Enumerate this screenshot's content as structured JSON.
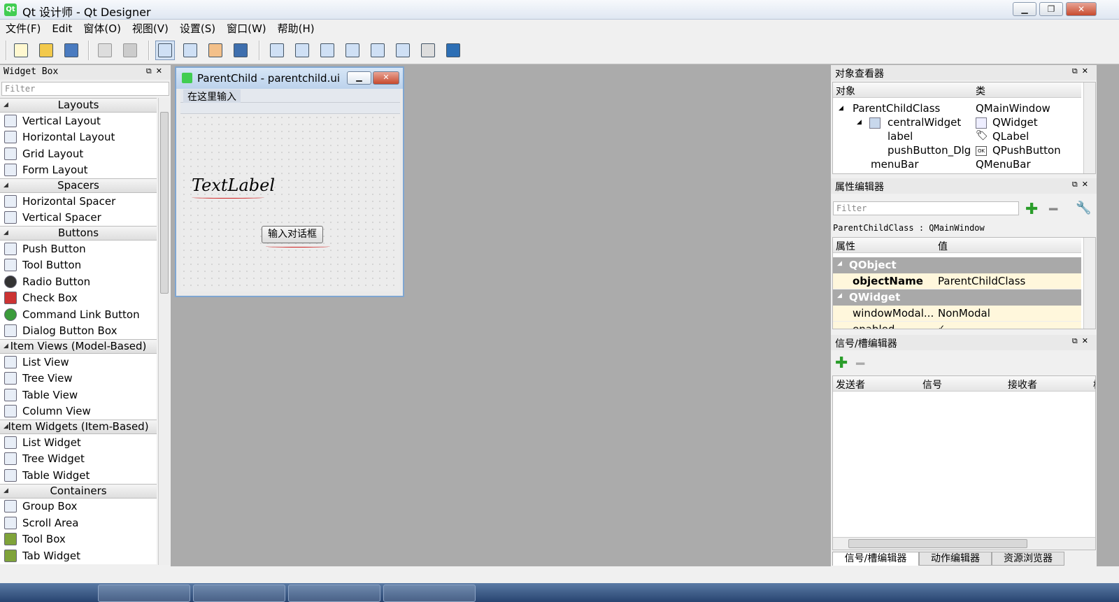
{
  "window": {
    "title": "Qt 设计师 - Qt Designer",
    "icon_text": "Qt",
    "min_icon": "minimize-icon",
    "max_icon": "maximize-icon",
    "close_icon": "close-icon"
  },
  "menu": [
    "文件(F)",
    "Edit",
    "窗体(O)",
    "视图(V)",
    "设置(S)",
    "窗口(W)",
    "帮助(H)"
  ],
  "widget_box": {
    "title": "Widget Box",
    "filter_placeholder": "Filter",
    "categories": [
      {
        "name": "Layouts",
        "items": [
          "Vertical Layout",
          "Horizontal Layout",
          "Grid Layout",
          "Form Layout"
        ]
      },
      {
        "name": "Spacers",
        "items": [
          "Horizontal Spacer",
          "Vertical Spacer"
        ]
      },
      {
        "name": "Buttons",
        "items": [
          "Push Button",
          "Tool Button",
          "Radio Button",
          "Check Box",
          "Command Link Button",
          "Dialog Button Box"
        ]
      },
      {
        "name": "Item Views (Model-Based)",
        "items": [
          "List View",
          "Tree View",
          "Table View",
          "Column View"
        ]
      },
      {
        "name": "Item Widgets (Item-Based)",
        "items": [
          "List Widget",
          "Tree Widget",
          "Table Widget"
        ]
      },
      {
        "name": "Containers",
        "items": [
          "Group Box",
          "Scroll Area",
          "Tool Box",
          "Tab Widget"
        ]
      }
    ]
  },
  "form": {
    "title": "ParentChild - parentchild.ui",
    "menu_placeholder": "在这里输入",
    "label_text": "TextLabel",
    "button_text": "输入对话框"
  },
  "object_inspector": {
    "title": "对象查看器",
    "col_object": "对象",
    "col_class": "类",
    "rows": [
      {
        "object": "ParentChildClass",
        "class": "QMainWindow"
      },
      {
        "object": "centralWidget",
        "class": "QWidget"
      },
      {
        "object": "label",
        "class": "QLabel"
      },
      {
        "object": "pushButton_Dlg",
        "class": "QPushButton"
      },
      {
        "object": "menuBar",
        "class": "QMenuBar"
      }
    ]
  },
  "property_editor": {
    "title": "属性编辑器",
    "filter_placeholder": "Filter",
    "context": "ParentChildClass : QMainWindow",
    "col_property": "属性",
    "col_value": "值",
    "groups": [
      {
        "name": "QObject",
        "props": [
          {
            "name": "objectName",
            "value": "ParentChildClass"
          }
        ]
      },
      {
        "name": "QWidget",
        "props": [
          {
            "name": "windowModal...",
            "value": "NonModal"
          },
          {
            "name": "enabled",
            "value": "✓"
          }
        ]
      }
    ]
  },
  "signal_slot": {
    "title": "信号/槽编辑器",
    "cols": [
      "发送者",
      "信号",
      "接收者",
      "槽"
    ],
    "tabs": [
      "信号/槽编辑器",
      "动作编辑器",
      "资源浏览器"
    ]
  },
  "colors": {
    "accent": "#7fa6d1",
    "group_header": "#a9a9a9",
    "prop_row": "#fff7dc",
    "spell_error": "#d02020"
  }
}
